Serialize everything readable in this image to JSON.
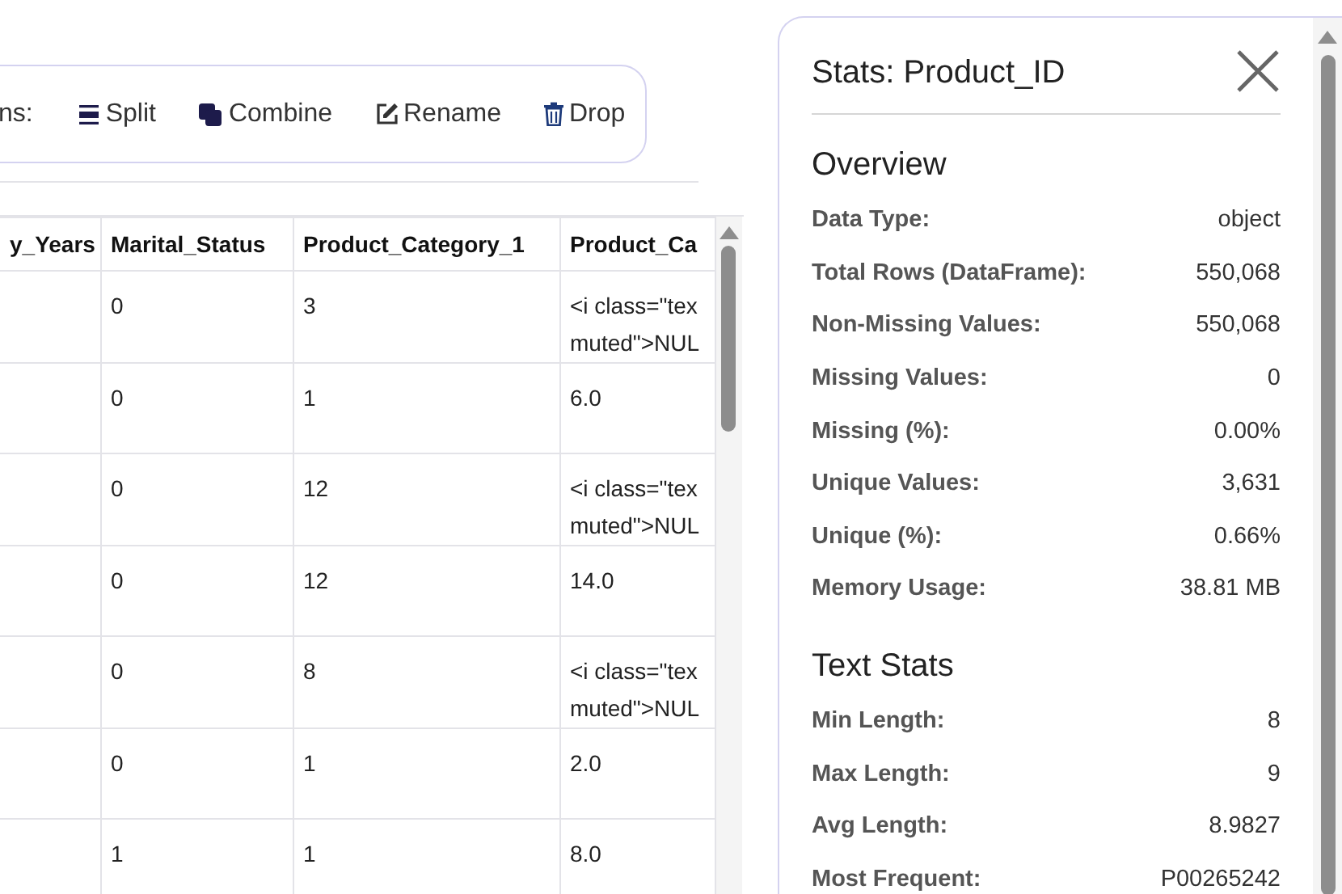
{
  "toolbar": {
    "label": "ns:",
    "actions": [
      {
        "kind": "split",
        "label": "Split"
      },
      {
        "kind": "combine",
        "label": "Combine"
      },
      {
        "kind": "rename",
        "label": "Rename"
      },
      {
        "kind": "drop",
        "label": "Drop"
      }
    ]
  },
  "table": {
    "columns": [
      "y_Years",
      "Marital_Status",
      "Product_Category_1",
      "Product_Ca"
    ],
    "rows": [
      {
        "cells": [
          [],
          [
            "0"
          ],
          [
            "3"
          ],
          [
            "<i class=\"tex",
            "muted\">NUL"
          ]
        ]
      },
      {
        "cells": [
          [],
          [
            "0"
          ],
          [
            "1"
          ],
          [
            "6.0"
          ]
        ]
      },
      {
        "cells": [
          [],
          [
            "0"
          ],
          [
            "12"
          ],
          [
            "<i class=\"tex",
            "muted\">NUL"
          ]
        ]
      },
      {
        "cells": [
          [],
          [
            "0"
          ],
          [
            "12"
          ],
          [
            "14.0"
          ]
        ]
      },
      {
        "cells": [
          [],
          [
            "0"
          ],
          [
            "8"
          ],
          [
            "<i class=\"tex",
            "muted\">NUL"
          ]
        ]
      },
      {
        "cells": [
          [],
          [
            "0"
          ],
          [
            "1"
          ],
          [
            "2.0"
          ]
        ]
      },
      {
        "cells": [
          [],
          [
            "1"
          ],
          [
            "1"
          ],
          [
            "8.0"
          ]
        ]
      }
    ]
  },
  "stats_panel": {
    "title": "Stats: Product_ID",
    "sections": [
      {
        "heading": "Overview",
        "rows": [
          {
            "label": "Data Type:",
            "value": "object"
          },
          {
            "label": "Total Rows (DataFrame):",
            "value": "550,068"
          },
          {
            "label": "Non-Missing Values:",
            "value": "550,068"
          },
          {
            "label": "Missing Values:",
            "value": "0"
          },
          {
            "label": "Missing (%):",
            "value": "0.00%"
          },
          {
            "label": "Unique Values:",
            "value": "3,631"
          },
          {
            "label": "Unique (%):",
            "value": "0.66%"
          },
          {
            "label": "Memory Usage:",
            "value": "38.81 MB"
          }
        ]
      },
      {
        "heading": "Text Stats",
        "rows": [
          {
            "label": "Min Length:",
            "value": "8"
          },
          {
            "label": "Max Length:",
            "value": "9"
          },
          {
            "label": "Avg Length:",
            "value": "8.9827"
          },
          {
            "label": "Most Frequent:",
            "value": "P00265242"
          }
        ]
      }
    ]
  }
}
